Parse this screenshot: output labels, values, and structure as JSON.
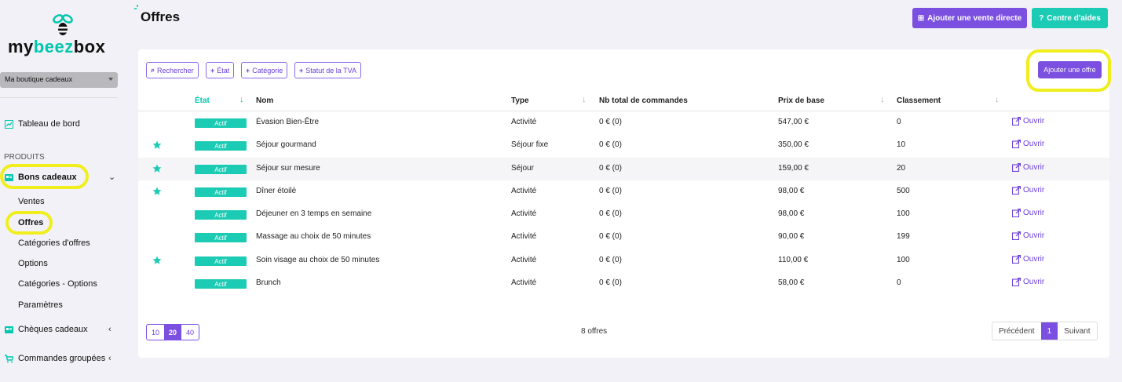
{
  "sidebar": {
    "logo": {
      "part1": "my",
      "part2": "beez",
      "part3": "box"
    },
    "shop_select": "Ma boutique cadeaux",
    "dashboard": "Tableau de bord",
    "section_products": "PRODUITS",
    "gift_vouchers": "Bons cadeaux",
    "sub_items": [
      "Ventes",
      "Offres",
      "Catégories d'offres",
      "Options",
      "Catégories - Options",
      "Paramètres"
    ],
    "gift_cheques": "Chèques cadeaux",
    "group_orders": "Commandes groupées"
  },
  "header": {
    "title": "Offres",
    "btn_direct_sale": "Ajouter une vente directe",
    "btn_help": "Centre d'aides"
  },
  "filters": [
    "Rechercher",
    "État",
    "Catégorie",
    "Statut de la TVA"
  ],
  "add_offer": "Ajouter une offre",
  "columns": {
    "state": "État",
    "name": "Nom",
    "type": "Type",
    "orders": "Nb total de commandes",
    "price": "Prix de base",
    "rank": "Classement"
  },
  "rows": [
    {
      "star": false,
      "state": "Actif",
      "name": "Évasion Bien-Être",
      "type": "Activité",
      "orders": "0 € (0)",
      "price": "547,00 €",
      "rank": "0",
      "open": "Ouvrir"
    },
    {
      "star": true,
      "state": "Actif",
      "name": "Séjour gourmand",
      "type": "Séjour fixe",
      "orders": "0 € (0)",
      "price": "350,00 €",
      "rank": "10",
      "open": "Ouvrir"
    },
    {
      "star": true,
      "state": "Actif",
      "name": "Séjour sur mesure",
      "type": "Séjour",
      "orders": "0 € (0)",
      "price": "159,00 €",
      "rank": "20",
      "open": "Ouvrir"
    },
    {
      "star": true,
      "state": "Actif",
      "name": "Dîner étoilé",
      "type": "Activité",
      "orders": "0 € (0)",
      "price": "98,00 €",
      "rank": "500",
      "open": "Ouvrir"
    },
    {
      "star": false,
      "state": "Actif",
      "name": "Déjeuner en 3 temps en semaine",
      "type": "Activité",
      "orders": "0 € (0)",
      "price": "98,00 €",
      "rank": "100",
      "open": "Ouvrir"
    },
    {
      "star": false,
      "state": "Actif",
      "name": "Massage au choix de 50 minutes",
      "type": "Activité",
      "orders": "0 € (0)",
      "price": "90,00 €",
      "rank": "199",
      "open": "Ouvrir"
    },
    {
      "star": true,
      "state": "Actif",
      "name": "Soin visage au choix de 50 minutes",
      "type": "Activité",
      "orders": "0 € (0)",
      "price": "110,00 €",
      "rank": "100",
      "open": "Ouvrir"
    },
    {
      "star": false,
      "state": "Actif",
      "name": "Brunch",
      "type": "Activité",
      "orders": "0 € (0)",
      "price": "58,00 €",
      "rank": "0",
      "open": "Ouvrir"
    }
  ],
  "pagination": {
    "sizes": [
      "10",
      "20",
      "40"
    ],
    "selected_size": "20",
    "count": "8 offres",
    "prev": "Précédent",
    "current": "1",
    "next": "Suivant"
  },
  "colors": {
    "accent": "#7b4fe0",
    "teal": "#1ccbb4",
    "highlight": "#f0ee1c"
  }
}
